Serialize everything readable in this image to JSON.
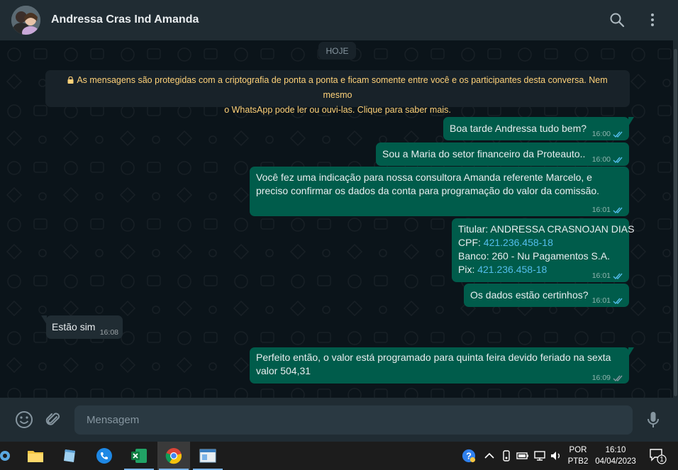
{
  "header": {
    "contact_name": "Andressa Cras Ind Amanda"
  },
  "chat": {
    "day_label": "HOJE",
    "encryption_notice_line1": "As mensagens são protegidas com a criptografia de ponta a ponta e ficam somente entre você e os participantes desta conversa. Nem mesmo",
    "encryption_notice_line2": "o WhatsApp pode ler ou ouvi-las. Clique para saber mais.",
    "messages": [
      {
        "direction": "out",
        "text": "Boa tarde Andressa tudo bem?",
        "time": "16:00"
      },
      {
        "direction": "out",
        "text": "Sou a Maria do setor financeiro da Proteauto..",
        "time": "16:00"
      },
      {
        "direction": "out",
        "line1": "Você fez uma indicação para nossa consultora Amanda referente Marcelo, e",
        "line2": "preciso confirmar os dados da conta para programação do valor da comissão.",
        "time": "16:01"
      },
      {
        "direction": "out",
        "line1": "Titular: ANDRESSA CRASNOJAN DIAS",
        "cpf_label": "CPF: ",
        "cpf_value": "421.236.458-18",
        "line3": "Banco: 260 - Nu Pagamentos S.A.",
        "pix_label": "Pix: ",
        "pix_value": "421.236.458-18",
        "time": "16:01"
      },
      {
        "direction": "out",
        "text": "Os dados estão certinhos?",
        "time": "16:01"
      },
      {
        "direction": "in",
        "text": "Estão sim",
        "time": "16:08"
      },
      {
        "direction": "out",
        "line1": "Perfeito então, o valor está programado para quinta feira  devido feriado na sexta",
        "line2": "valor 504,31",
        "time": "16:09"
      }
    ]
  },
  "composer": {
    "placeholder": "Mensagem"
  },
  "taskbar": {
    "language_line1": "POR",
    "language_line2": "PTB2",
    "clock_time": "16:10",
    "clock_date": "04/04/2023",
    "notification_count": "1"
  },
  "colors": {
    "header_bg": "#202c33",
    "chat_bg": "#0b141a",
    "outgoing_bubble": "#005c4b",
    "incoming_bubble": "#202c33",
    "link": "#53bdeb",
    "notice_text": "#ffd279",
    "read_ticks": "#53bdeb"
  }
}
